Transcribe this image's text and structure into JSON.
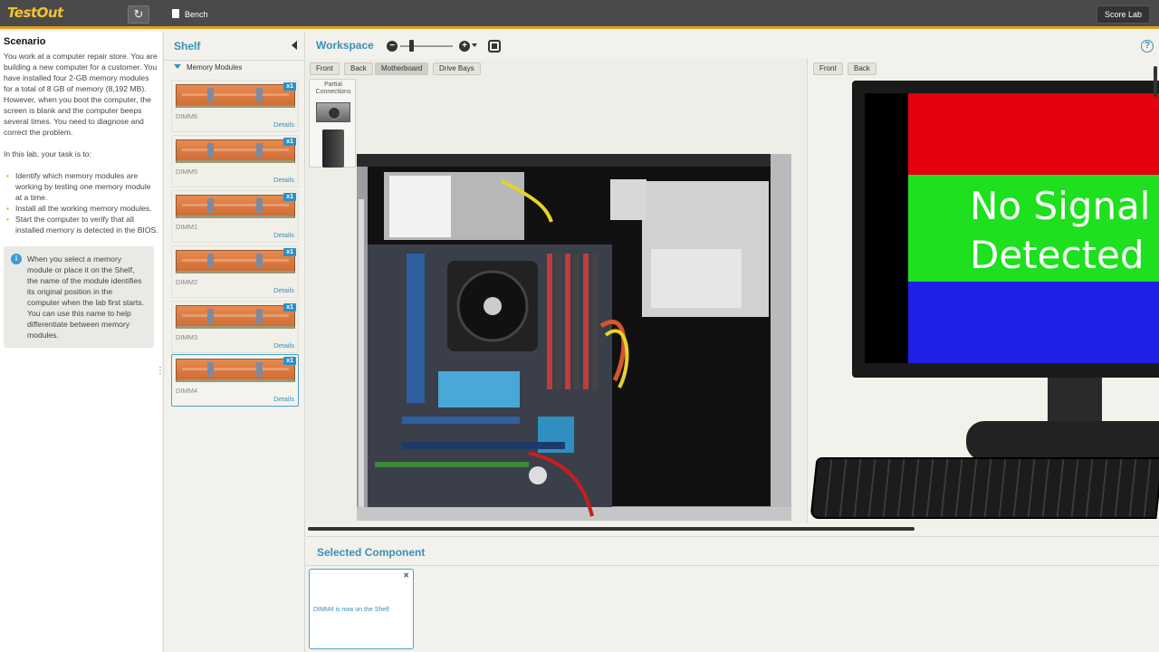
{
  "app": {
    "logo": "TestOut",
    "tab": "Bench",
    "score_label": "Score Lab"
  },
  "scenario": {
    "title": "Scenario",
    "intro": "You work at a computer repair store. You are building a new computer for a customer. You have installed four 2-GB memory modules for a total of 8 GB of memory (8,192 MB). However, when you boot the computer, the screen is blank and the computer beeps several times. You need to diagnose and correct the problem.",
    "task_intro": "In this lab, your task is to:",
    "tasks": [
      "Identify which memory modules are working by testing one memory module at a time.",
      "Install all the working memory modules.",
      "Start the computer to verify that all installed memory is detected in the BIOS."
    ],
    "note": "When you select a memory module or place it on the Shelf, the name of the module identifies its original position in the computer when the lab first starts. You can use this name to help differentiate between memory modules."
  },
  "shelf": {
    "title": "Shelf",
    "group": "Memory Modules",
    "details_label": "Details",
    "items": [
      {
        "name": "DIMM6",
        "qty": "x1"
      },
      {
        "name": "DIMM5",
        "qty": "x1"
      },
      {
        "name": "DIMM1",
        "qty": "x1"
      },
      {
        "name": "DIMM2",
        "qty": "x1"
      },
      {
        "name": "DIMM3",
        "qty": "x1"
      },
      {
        "name": "DIMM4",
        "qty": "x1"
      }
    ]
  },
  "workspace": {
    "title": "Workspace",
    "left_views": [
      "Front",
      "Back",
      "Motherboard",
      "Drive Bays"
    ],
    "right_views": [
      "Front",
      "Back"
    ],
    "partial_label": "Partial Connections",
    "monitor_text_line1": "No Signal",
    "monitor_text_line2": "Detected",
    "help": "?"
  },
  "selected": {
    "title": "Selected Component",
    "message": "DIMM4 is now on the Shelf"
  },
  "colors": {
    "accent": "#3a8fb8",
    "brand": "#f2c230",
    "topbar": "#4a4a4a"
  }
}
